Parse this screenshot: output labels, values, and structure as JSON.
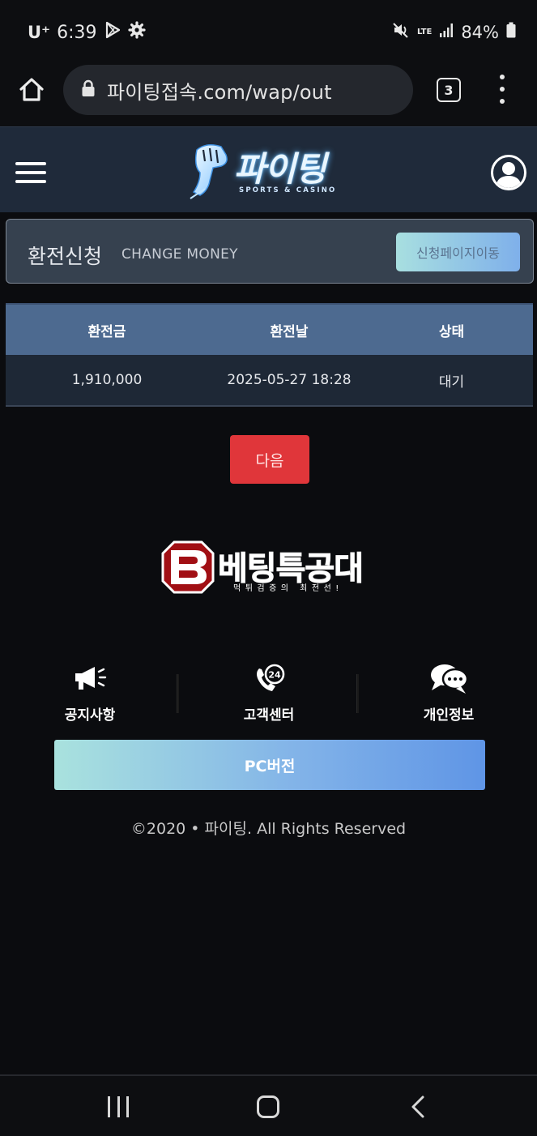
{
  "status_bar": {
    "carrier": "U⁺",
    "time": "6:39",
    "network": "LTE",
    "battery": "84%"
  },
  "browser": {
    "url": "파이팅접속.com/wap/out",
    "tab_count": "3"
  },
  "header": {
    "logo_text": "파이팅",
    "logo_sub": "SPORTS & CASINO"
  },
  "panel": {
    "title": "환전신청",
    "subtitle": "CHANGE MONEY",
    "apply_button": "신청페이지이동"
  },
  "table": {
    "columns": [
      "환전금",
      "환전날",
      "상태"
    ],
    "rows": [
      {
        "amount": "1,910,000",
        "date": "2025-05-27 18:28",
        "status": "대기"
      }
    ]
  },
  "next_button": "다음",
  "watermark": {
    "name": "베팅특공대",
    "tagline": "먹튀검증의 최전선!"
  },
  "footer": {
    "items": [
      {
        "label": "공지사항",
        "icon": "megaphone-icon"
      },
      {
        "label": "고객센터",
        "icon": "phone-24-icon"
      },
      {
        "label": "개인정보",
        "icon": "chat-bubbles-icon"
      }
    ],
    "pc_button": "PC버전",
    "copyright": "©2020 • 파이팅. All Rights Reserved"
  },
  "colors": {
    "header_bg": "#1f2a3a",
    "table_head": "#4d6a90",
    "next_red": "#e0363a",
    "pc_gradient_start": "#a9e2de",
    "pc_gradient_end": "#5f95e6"
  }
}
